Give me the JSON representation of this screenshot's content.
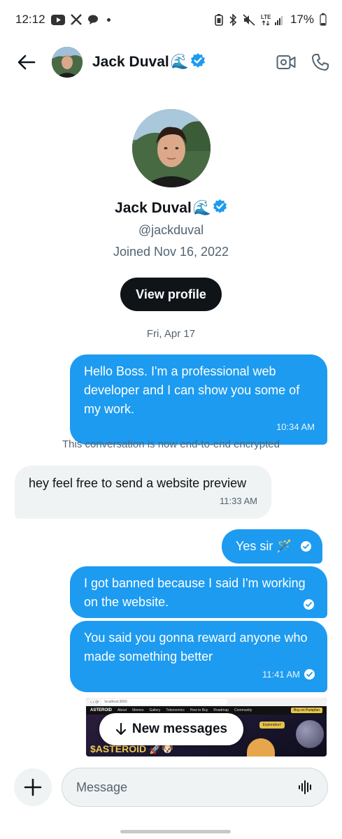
{
  "status_bar": {
    "time": "12:12",
    "battery": "17%"
  },
  "header": {
    "name": "Jack Duval",
    "name_emoji": "🌊"
  },
  "profile": {
    "name": "Jack Duval",
    "name_emoji": "🌊",
    "handle": "@jackduval",
    "joined": "Joined Nov 16, 2022",
    "view_profile_label": "View profile"
  },
  "conversation": {
    "date_separator": "Fri, Apr 17",
    "encryption_note": "This conversation is now end-to-end encrypted",
    "messages": [
      {
        "direction": "sent",
        "text": "Hello Boss. I'm a professional web developer and I can show you some of my work.",
        "time": "10:34 AM",
        "read": false
      },
      {
        "direction": "received",
        "text": "hey feel free to send a website preview",
        "time": "11:33 AM"
      },
      {
        "direction": "sent",
        "text": "Yes sir 🪄",
        "time": "",
        "read": true
      },
      {
        "direction": "sent",
        "text": "I got banned because I said I'm working on the website.",
        "time": "",
        "read": true
      },
      {
        "direction": "sent",
        "text": "You said you gonna reward anyone who made something better",
        "time": "11:41 AM",
        "read": true
      }
    ],
    "attachment": {
      "url": "localhost:3000",
      "nav_items": [
        "About",
        "Memes",
        "Gallery",
        "Tokenomics",
        "How to Buy",
        "Roadmap",
        "Community"
      ],
      "brand": "ASTEROID",
      "cta": "Buy on Pumpfun",
      "hero_button": "Exploration!",
      "hero_title": "$ASTEROID 🚀🐶"
    },
    "new_messages_label": "New messages"
  },
  "composer": {
    "placeholder": "Message"
  },
  "colors": {
    "accent": "#1d9bf0",
    "bubble_received": "#eff3f4",
    "primary_text": "#0f1419",
    "secondary_text": "#536471"
  },
  "icons": {
    "back": "arrow-left-icon",
    "verified": "verified-badge-icon",
    "video": "video-call-icon",
    "phone": "phone-icon",
    "plus": "plus-icon",
    "voice": "voice-waveform-icon",
    "read": "read-check-icon"
  }
}
